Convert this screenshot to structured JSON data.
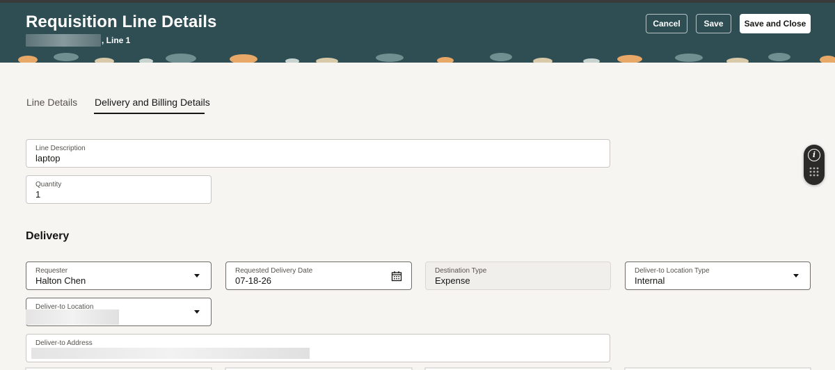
{
  "header": {
    "title": "Requisition Line Details",
    "subtitle_suffix": ", Line 1",
    "buttons": {
      "cancel": "Cancel",
      "save": "Save",
      "save_close": "Save and Close"
    }
  },
  "tabs": [
    {
      "label": "Line Details",
      "active": false
    },
    {
      "label": "Delivery and Billing Details",
      "active": true
    }
  ],
  "fields": {
    "line_description": {
      "label": "Line Description",
      "value": "laptop"
    },
    "quantity": {
      "label": "Quantity",
      "value": "1"
    }
  },
  "delivery": {
    "title": "Delivery",
    "requester": {
      "label": "Requester",
      "value": "Halton Chen"
    },
    "requested_date": {
      "label": "Requested Delivery Date",
      "value": "07-18-26"
    },
    "destination_type": {
      "label": "Destination Type",
      "value": "Expense"
    },
    "location_type": {
      "label": "Deliver-to Location Type",
      "value": "Internal"
    },
    "location": {
      "label": "Deliver-to Location"
    },
    "address": {
      "label": "Deliver-to Address"
    }
  },
  "icons": [
    "calendar-icon",
    "dropdown-caret-icon",
    "info-icon",
    "grid-dots-icon"
  ],
  "colors": {
    "header_bg": "#2f4e54",
    "page_bg": "#f6f5f2"
  }
}
